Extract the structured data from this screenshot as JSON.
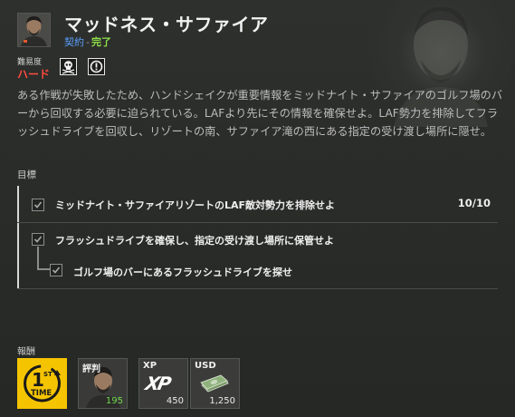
{
  "mission": {
    "title": "マッドネス・サファイア",
    "status_label": "契約",
    "status_separator": "-",
    "status_value": "完了"
  },
  "difficulty": {
    "label": "難易度",
    "value": "ハード",
    "icons": [
      "skull-icon",
      "exclamation-icon"
    ]
  },
  "description": "ある作戦が失敗したため、ハンドシェイクが重要情報をミッドナイト・サファイアのゴルフ場のバーから回収する必要に迫られている。LAFより先にその情報を確保せよ。LAF勢力を排除してフラッシュドライブを回収し、リゾートの南、サファイア滝の西にある指定の受け渡し場所に隠せ。",
  "objectives": {
    "heading": "目標",
    "items": [
      {
        "text": "ミッドナイト・サファイアリゾートのLAF敵対勢力を排除せよ",
        "count": "10/10",
        "checked": true
      },
      {
        "text": "フラッシュドライブを確保し、指定の受け渡し場所に保管せよ",
        "checked": true
      },
      {
        "text": "ゴルフ場のバーにあるフラッシュドライブを探せ",
        "checked": true,
        "sub": true
      }
    ]
  },
  "rewards": {
    "heading": "報酬",
    "cards": [
      {
        "id": "first-time",
        "badge_top": "1",
        "badge_sup": "ST",
        "badge_bottom": "TIME",
        "color": "#f5c400"
      },
      {
        "id": "reputation",
        "label": "評判",
        "value": "195",
        "value_color": "#6fd94a"
      },
      {
        "id": "xp",
        "label": "XP",
        "logo": "XP",
        "value": "450"
      },
      {
        "id": "usd",
        "label": "USD",
        "value": "1,250"
      }
    ]
  },
  "colors": {
    "accent_blue": "#5aa0ff",
    "complete_green": "#8ee04a",
    "hard_red": "#ff4a3d",
    "first_time_yellow": "#f5c400"
  }
}
